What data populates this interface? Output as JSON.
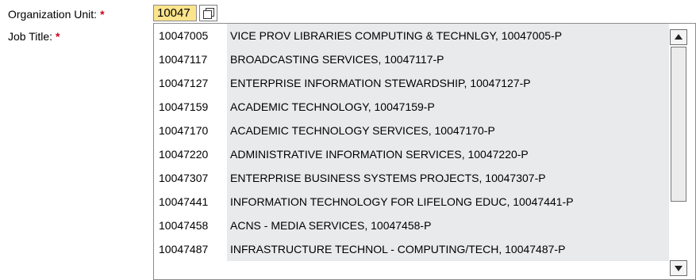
{
  "form": {
    "org_unit": {
      "label": "Organization Unit:",
      "required_mark": "*",
      "value": "10047",
      "value_help_icon": "value-help-icon"
    },
    "job_title": {
      "label": "Job Title:",
      "required_mark": "*"
    }
  },
  "dropdown": {
    "items": [
      {
        "key": "10047005",
        "text": "VICE PROV LIBRARIES COMPUTING & TECHNLGY, 10047005-P"
      },
      {
        "key": "10047117",
        "text": "BROADCASTING SERVICES, 10047117-P"
      },
      {
        "key": "10047127",
        "text": "ENTERPRISE INFORMATION STEWARDSHIP, 10047127-P"
      },
      {
        "key": "10047159",
        "text": "ACADEMIC TECHNOLOGY, 10047159-P"
      },
      {
        "key": "10047170",
        "text": "ACADEMIC TECHNOLOGY SERVICES, 10047170-P"
      },
      {
        "key": "10047220",
        "text": "ADMINISTRATIVE INFORMATION SERVICES, 10047220-P"
      },
      {
        "key": "10047307",
        "text": "ENTERPRISE BUSINESS SYSTEMS PROJECTS, 10047307-P"
      },
      {
        "key": "10047441",
        "text": "INFORMATION TECHNOLOGY FOR LIFELONG EDUC, 10047441-P"
      },
      {
        "key": "10047458",
        "text": "ACNS - MEDIA SERVICES, 10047458-P"
      },
      {
        "key": "10047487",
        "text": "INFRASTRUCTURE TECHNOL - COMPUTING/TECH, 10047487-P"
      }
    ],
    "scroll_up_icon": "chevron-up-icon",
    "scroll_down_icon": "chevron-down-icon"
  },
  "colors": {
    "input_background": "#fbe48c",
    "required_star": "#d0021b",
    "item_text_background": "#e8eaec"
  }
}
